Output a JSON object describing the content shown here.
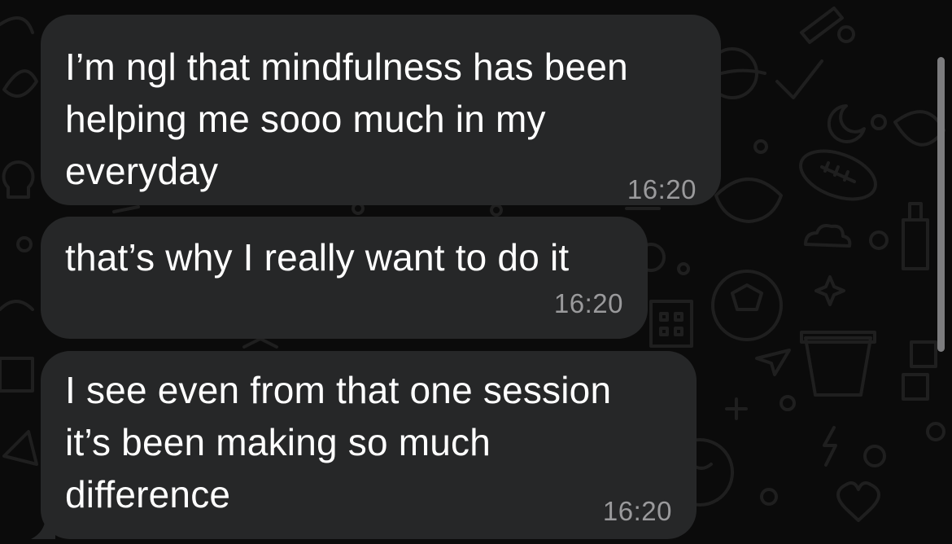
{
  "messages": [
    {
      "text": "I’m ngl that mindfulness has been\nhelping me sooo much in my\neveryday",
      "time": "16:20"
    },
    {
      "text": "that’s why I really want to do it",
      "time": "16:20"
    },
    {
      "text": "I see even from that one session\nit’s been making so much\ndifference",
      "time": "16:20"
    }
  ],
  "colors": {
    "background": "#0b0b0b",
    "bubble": "#262728",
    "text": "#ffffff",
    "timestamp": "#9a9a9c",
    "wallpaper_doodle": "#1f1f1f"
  }
}
